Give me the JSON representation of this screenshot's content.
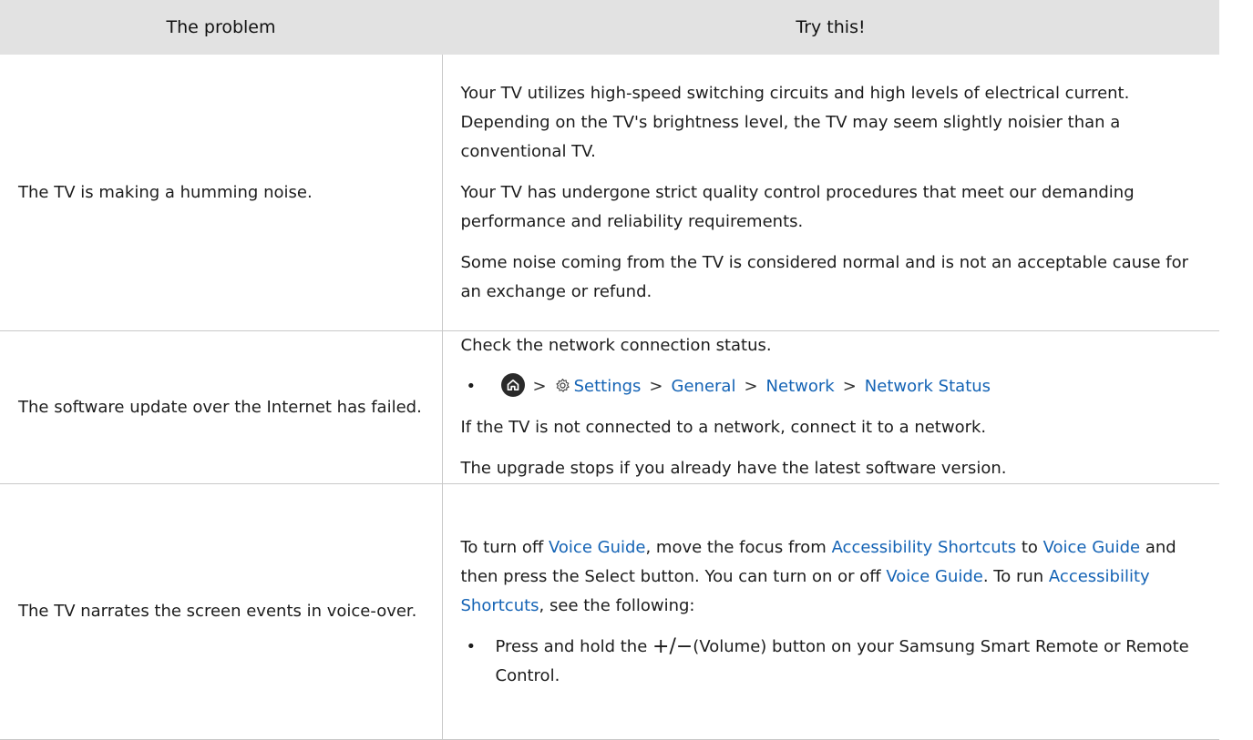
{
  "table": {
    "header_problem": "The problem",
    "header_try": "Try this!"
  },
  "rows": [
    {
      "problem": "The TV is making a humming noise.",
      "paragraphs": [
        "Your TV utilizes high-speed switching circuits and high levels of electrical current. Depending on the TV's brightness level, the TV may seem slightly noisier than a conventional TV.",
        "Your TV has undergone strict quality control procedures that meet our demanding performance and reliability requirements.",
        "Some noise coming from the TV is considered normal and is not an acceptable cause for an exchange or refund."
      ]
    },
    {
      "problem": "The software update over the Internet has failed.",
      "intro": "Check the network connection status.",
      "path": [
        "Settings",
        "General",
        "Network",
        "Network Status"
      ],
      "after": [
        "If the TV is not connected to a network, connect it to a network.",
        "The upgrade stops if you already have the latest software version."
      ]
    },
    {
      "problem": "The TV narrates the screen events in voice-over.",
      "text": {
        "t1": "To turn off ",
        "l1": "Voice Guide",
        "t2": ", move the focus from ",
        "l2": "Accessibility Shortcuts",
        "t3": " to ",
        "l3": "Voice Guide",
        "t4": " and then press the Select button. You can turn on or off ",
        "l4": "Voice Guide",
        "t5": ". To run ",
        "l5": "Accessibility Shortcuts",
        "t6": ", see the following:"
      },
      "bullet": {
        "pre": "Press and hold the ",
        "symbol": "+/−",
        "post": "(Volume) button on your Samsung Smart Remote or Remote Control."
      }
    }
  ],
  "icons": {
    "home": "home-icon",
    "settings": "gear-icon",
    "chevron": "chevron-right-icon"
  },
  "colors": {
    "link": "#1463b5",
    "header_bg": "#e2e2e2",
    "border": "#c8c8c8"
  }
}
